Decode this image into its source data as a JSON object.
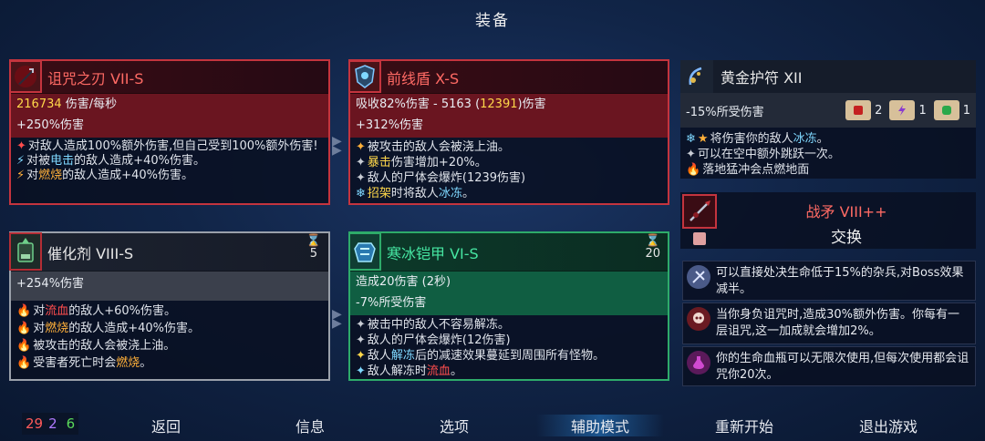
{
  "title": "装备",
  "weapons": [
    {
      "name": "诅咒之刃 VII-S",
      "stat1_val": "216734",
      "stat1_txt": " 伤害/每秒",
      "stat2": "+250%伤害",
      "desc": [
        {
          "b": "✦",
          "t": "对敌人造成100%额外伤害,但自己受到100%额外伤害!"
        },
        {
          "b": "⚡",
          "pre": "对被",
          "k": "电击",
          "post": "的敌人造成+40%伤害。"
        },
        {
          "b": "⚡",
          "pre": "对",
          "k": "燃烧",
          "post": "的敌人造成+40%伤害。"
        }
      ]
    },
    {
      "name": "前线盾 X-S",
      "stat1_a": "吸收82%伤害 - 5163 (",
      "stat1_b": "12391",
      "stat1_c": ")伤害",
      "stat2": "+312%伤害",
      "desc": [
        {
          "b": "✦",
          "t": "被攻击的敌人会被浇上油。"
        },
        {
          "b": "✦",
          "k": "暴击",
          "post": "伤害增加+20%。"
        },
        {
          "b": "✦",
          "t": "敌人的尸体会爆炸(1239伤害)"
        },
        {
          "b": "❄",
          "k": "招架",
          "pre": "",
          "post": "时将敌人",
          "k2": "冰冻",
          "post2": "。"
        }
      ]
    },
    {
      "name": "催化剂 VIII-S",
      "timer": "5",
      "stat2": "+254%伤害",
      "desc": [
        {
          "b": "🔥",
          "pre": "对",
          "k": "流血",
          "post": "的敌人+60%伤害。"
        },
        {
          "b": "🔥",
          "pre": "对",
          "k": "燃烧",
          "post": "的敌人造成+40%伤害。"
        },
        {
          "b": "🔥",
          "t": "被攻击的敌人会被浇上油。"
        },
        {
          "b": "🔥",
          "pre": "受害者死亡时会",
          "k": "燃烧",
          "post": "。"
        }
      ]
    },
    {
      "name": "寒冰铠甲 VI-S",
      "timer": "20",
      "stat1": "造成20伤害 (2秒)",
      "stat2": "-7%所受伤害",
      "desc": [
        {
          "b": "✦",
          "t": "被击中的敌人不容易解冻。"
        },
        {
          "b": "✦",
          "t": "敌人的尸体会爆炸(12伤害)"
        },
        {
          "b": "✦",
          "pre": "敌人",
          "k": "解冻",
          "post": "后的减速效果蔓延到周围所有怪物。"
        },
        {
          "b": "✦",
          "pre": "敌人解冻时",
          "k": "流血",
          "post": "。"
        }
      ]
    }
  ],
  "amulet": {
    "name": "黄金护符 XII",
    "stat": "-15%所受伤害",
    "scrolls": [
      {
        "icon": "red-fist-scroll",
        "count": "2",
        "color": "#c42020"
      },
      {
        "icon": "purple-bolt-scroll",
        "count": "1",
        "color": "#8a3ad0"
      },
      {
        "icon": "green-arm-scroll",
        "count": "1",
        "color": "#2aa84a"
      }
    ],
    "desc": [
      {
        "pre": "将伤害你的敌人",
        "k": "冰冻",
        "post": "。"
      },
      {
        "t": "可以在空中额外跳跃一次。"
      },
      {
        "t": "落地猛冲会点燃地面"
      }
    ]
  },
  "swap": {
    "name": "战矛 VIII++",
    "action": "交换"
  },
  "mutations": [
    {
      "icon": "execute-icon",
      "text": "可以直接处决生命低于15%的杂兵,对Boss效果减半。",
      "color": "#6a7ba8"
    },
    {
      "icon": "curse-skull-icon",
      "text": "当你身负诅咒时,造成30%额外伤害。你每有一层诅咒,这一加成就会增加2%。",
      "color": "#8a2a30"
    },
    {
      "icon": "potion-icon",
      "text": "你的生命血瓶可以无限次使用,但每次使用都会诅咒你20次。",
      "color": "#8a2a8a"
    }
  ],
  "scores": {
    "red": "29",
    "purple": "2",
    "green": "6",
    "red_color": "#ff5a5a",
    "purple_color": "#b07aff",
    "green_color": "#5ad85a"
  },
  "menu": [
    "返回",
    "信息",
    "选项",
    "辅助模式",
    "重新开始",
    "退出游戏"
  ]
}
